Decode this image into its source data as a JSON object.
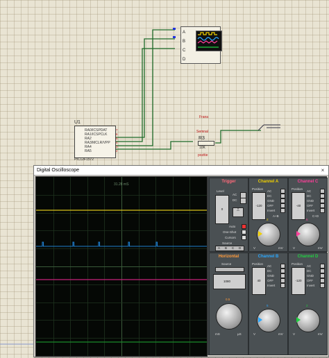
{
  "schematic": {
    "scope_pins": [
      "A",
      "B",
      "C",
      "D"
    ],
    "mcu": {
      "ref": "U1",
      "part": "PIC12F1572",
      "pins": [
        {
          "label": "RA0/ICSPDAT",
          "num": "7"
        },
        {
          "label": "RA1/ICSPCLK",
          "num": "6"
        },
        {
          "label": "RA2",
          "num": "5"
        },
        {
          "label": "RA3/MCLR/VPP",
          "num": "4"
        },
        {
          "label": "RA4",
          "num": "3"
        },
        {
          "label": "RA5",
          "num": "2"
        }
      ]
    },
    "resistor": {
      "ref": "R3",
      "value": "10K",
      "label_top1": "Frana",
      "label_top2": "Semnal",
      "label_bottom": "pozitie"
    }
  },
  "oscilloscope": {
    "window_title": "Digital Oscilloscope",
    "close_glyph": "×",
    "time_readout": "31.28 mS",
    "trigger": {
      "title": "Trigger",
      "level_label": "Level",
      "level_value": "0",
      "ac": "AC",
      "dc": "DC",
      "modes": [
        "Auto",
        "One-Shot",
        "Cursors"
      ],
      "source_label": "Source",
      "sources": [
        "A",
        "B",
        "C",
        "D"
      ]
    },
    "channels": [
      {
        "title": "Channel A",
        "color": "#f0d000",
        "position_label": "Position",
        "position_value": "-120",
        "modes": [
          "AC",
          "DC",
          "GND",
          "OFF",
          "Invert"
        ],
        "extra": "A+B",
        "units": [
          "V",
          "mV"
        ],
        "dial": "2"
      },
      {
        "title": "Channel C",
        "color": "#ff3f9a",
        "position_label": "Position",
        "position_value": "-40",
        "modes": [
          "AC",
          "DC",
          "GND",
          "OFF",
          "Invert"
        ],
        "extra": "C+D",
        "units": [
          "V",
          "mV"
        ],
        "dial": "5"
      },
      {
        "title": "Channel B",
        "color": "#2aa8ff",
        "position_label": "Position",
        "position_value": "40",
        "modes": [
          "AC",
          "DC",
          "GND",
          "OFF",
          "Invert"
        ],
        "extra": "",
        "units": [
          "V",
          "mV"
        ],
        "dial": "5"
      },
      {
        "title": "Channel D",
        "color": "#20d040",
        "position_label": "Position",
        "position_value": "-120",
        "modes": [
          "AC",
          "DC",
          "GND",
          "OFF",
          "Invert"
        ],
        "extra": "",
        "units": [
          "V",
          "mV"
        ],
        "dial": "2"
      }
    ],
    "horizontal": {
      "title": "Horizontal",
      "source_label": "Source",
      "position_value": "1080",
      "units": [
        "mS",
        "µS"
      ],
      "dial": "0.5"
    },
    "trace_colors": {
      "a": "#d8c21a",
      "b": "#1f7fd0",
      "c": "#c6237a",
      "d": "#1a8a2a"
    }
  }
}
